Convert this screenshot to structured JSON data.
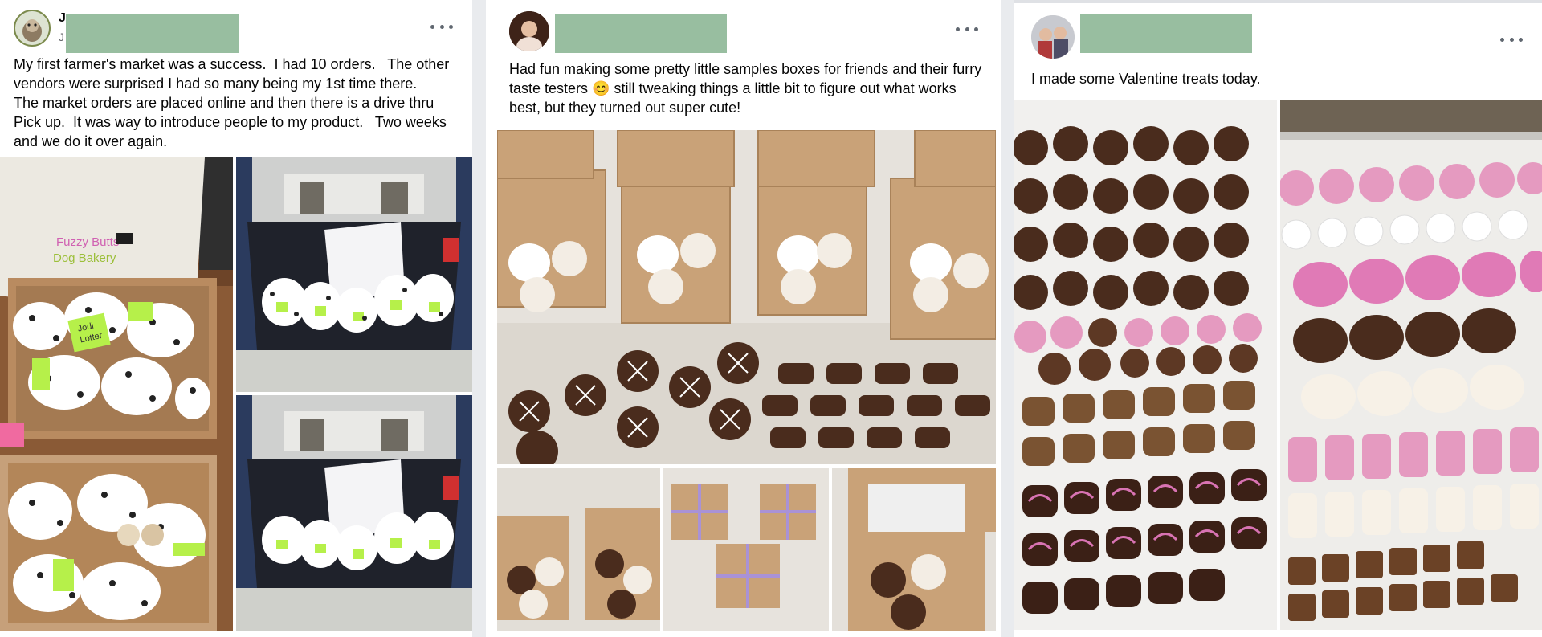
{
  "posts": [
    {
      "author_fragment": "J",
      "meta_fragment": "J",
      "text": "My first farmer's market was a success.  I had 10 orders.   The other vendors were surprised I had so many being my 1st time there.    The market orders are placed online and then there is a drive thru Pick up.  It was way to introduce people to my product.   Two weeks and we do it over again.",
      "bag_logo": [
        "Fuzzy Butts",
        "Dog Bakery"
      ],
      "note_text": [
        "Jodi",
        "Lotter"
      ]
    },
    {
      "text": "Had fun making some pretty little samples boxes for friends and their furry taste testers 😊 still tweaking things a little bit to figure out what works best, but they turned out super cute!"
    },
    {
      "text": "I made some Valentine treats today."
    }
  ],
  "colors": {
    "redaction": "#98bea0",
    "kraft_box": "#c9a278",
    "chocolate": "#4a2c1d",
    "pink_icing": "#e59ac0",
    "more_dots": "#606770"
  },
  "icons": {
    "more": "more-horizontal-icon"
  }
}
